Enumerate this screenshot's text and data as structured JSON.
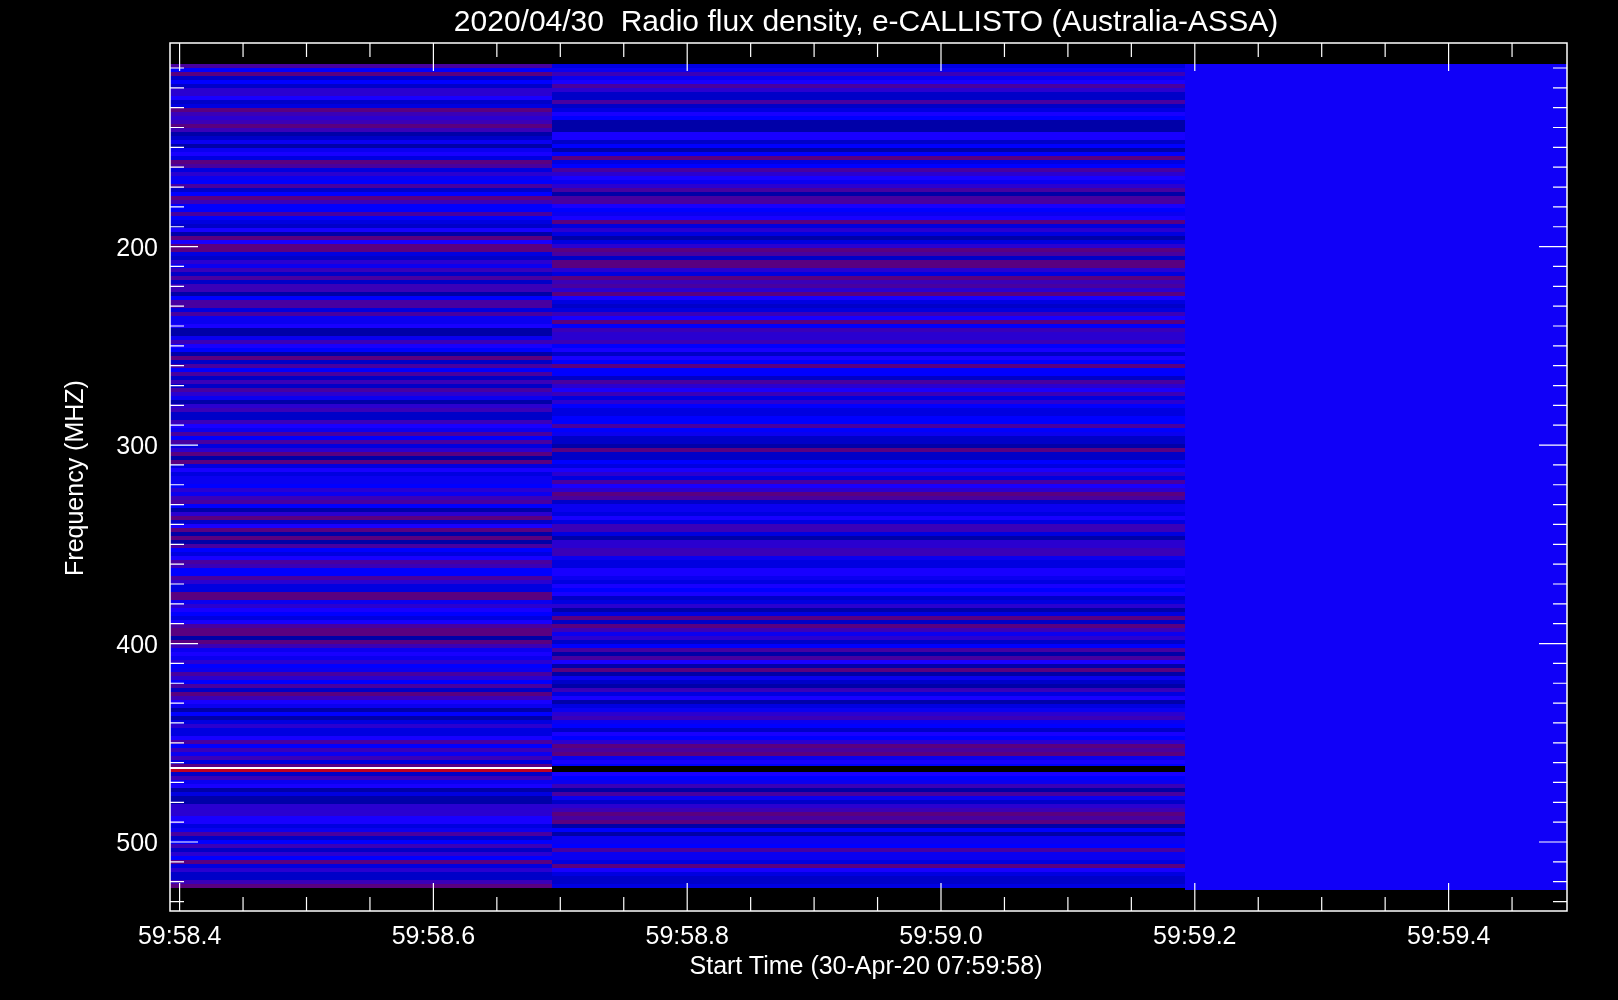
{
  "title": "2020/04/30  Radio flux density, e-CALLISTO (Australia-ASSA)",
  "plot": {
    "ylabel": "Frequency (MHZ)",
    "xlabel": "Start Time (30-Apr-20 07:59:58)",
    "yticks": [
      "200",
      "300",
      "400",
      "500"
    ],
    "xticks": [
      "59:58.4",
      "59:58.6",
      "59:58.8",
      "59:59.0",
      "59:59.2",
      "59:59.4"
    ]
  }
}
